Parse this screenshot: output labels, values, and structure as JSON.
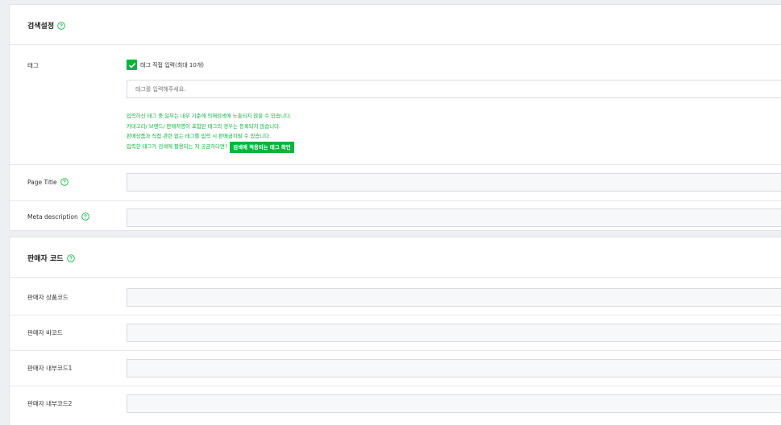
{
  "search_settings": {
    "title": "검색설정",
    "tag": {
      "label": "태그",
      "checkbox_label": "태그 직접 입력(최대 10개)",
      "checked": true,
      "input_placeholder": "태그를 입력해주세요.",
      "input_value": "",
      "help_lines": [
        "입력하신 태그 중 일부는 내부 기준에 의해검색에 노출되지 않을 수 있습니다.",
        "카테고리/ 브랜드/ 판매처명이 포함된 태그의 경우는 등록되지 않습니다.",
        "판매상품과 직접 관련 없는 태그를 입력 시 판매금지될 수 있습니다.",
        "입력한 태그가 검색에 활용되는 지 궁금하다면?"
      ],
      "check_button_label": "검색에 적용되는 태그 확인"
    },
    "page_title": {
      "label": "Page Title",
      "value": ""
    },
    "meta_description": {
      "label": "Meta description",
      "value": ""
    }
  },
  "seller_code": {
    "title": "판매자 코드",
    "fields": [
      {
        "label": "판매자 상품코드",
        "value": ""
      },
      {
        "label": "판매자 바코드",
        "value": ""
      },
      {
        "label": "판매자 내부코드1",
        "value": ""
      },
      {
        "label": "판매자 내부코드2",
        "value": ""
      }
    ]
  },
  "colors": {
    "accent_green": "#07b53b",
    "border": "#e1e3e8",
    "background": "#edeff3"
  },
  "icons": {
    "help": "help-circle-icon",
    "check": "check-icon"
  }
}
